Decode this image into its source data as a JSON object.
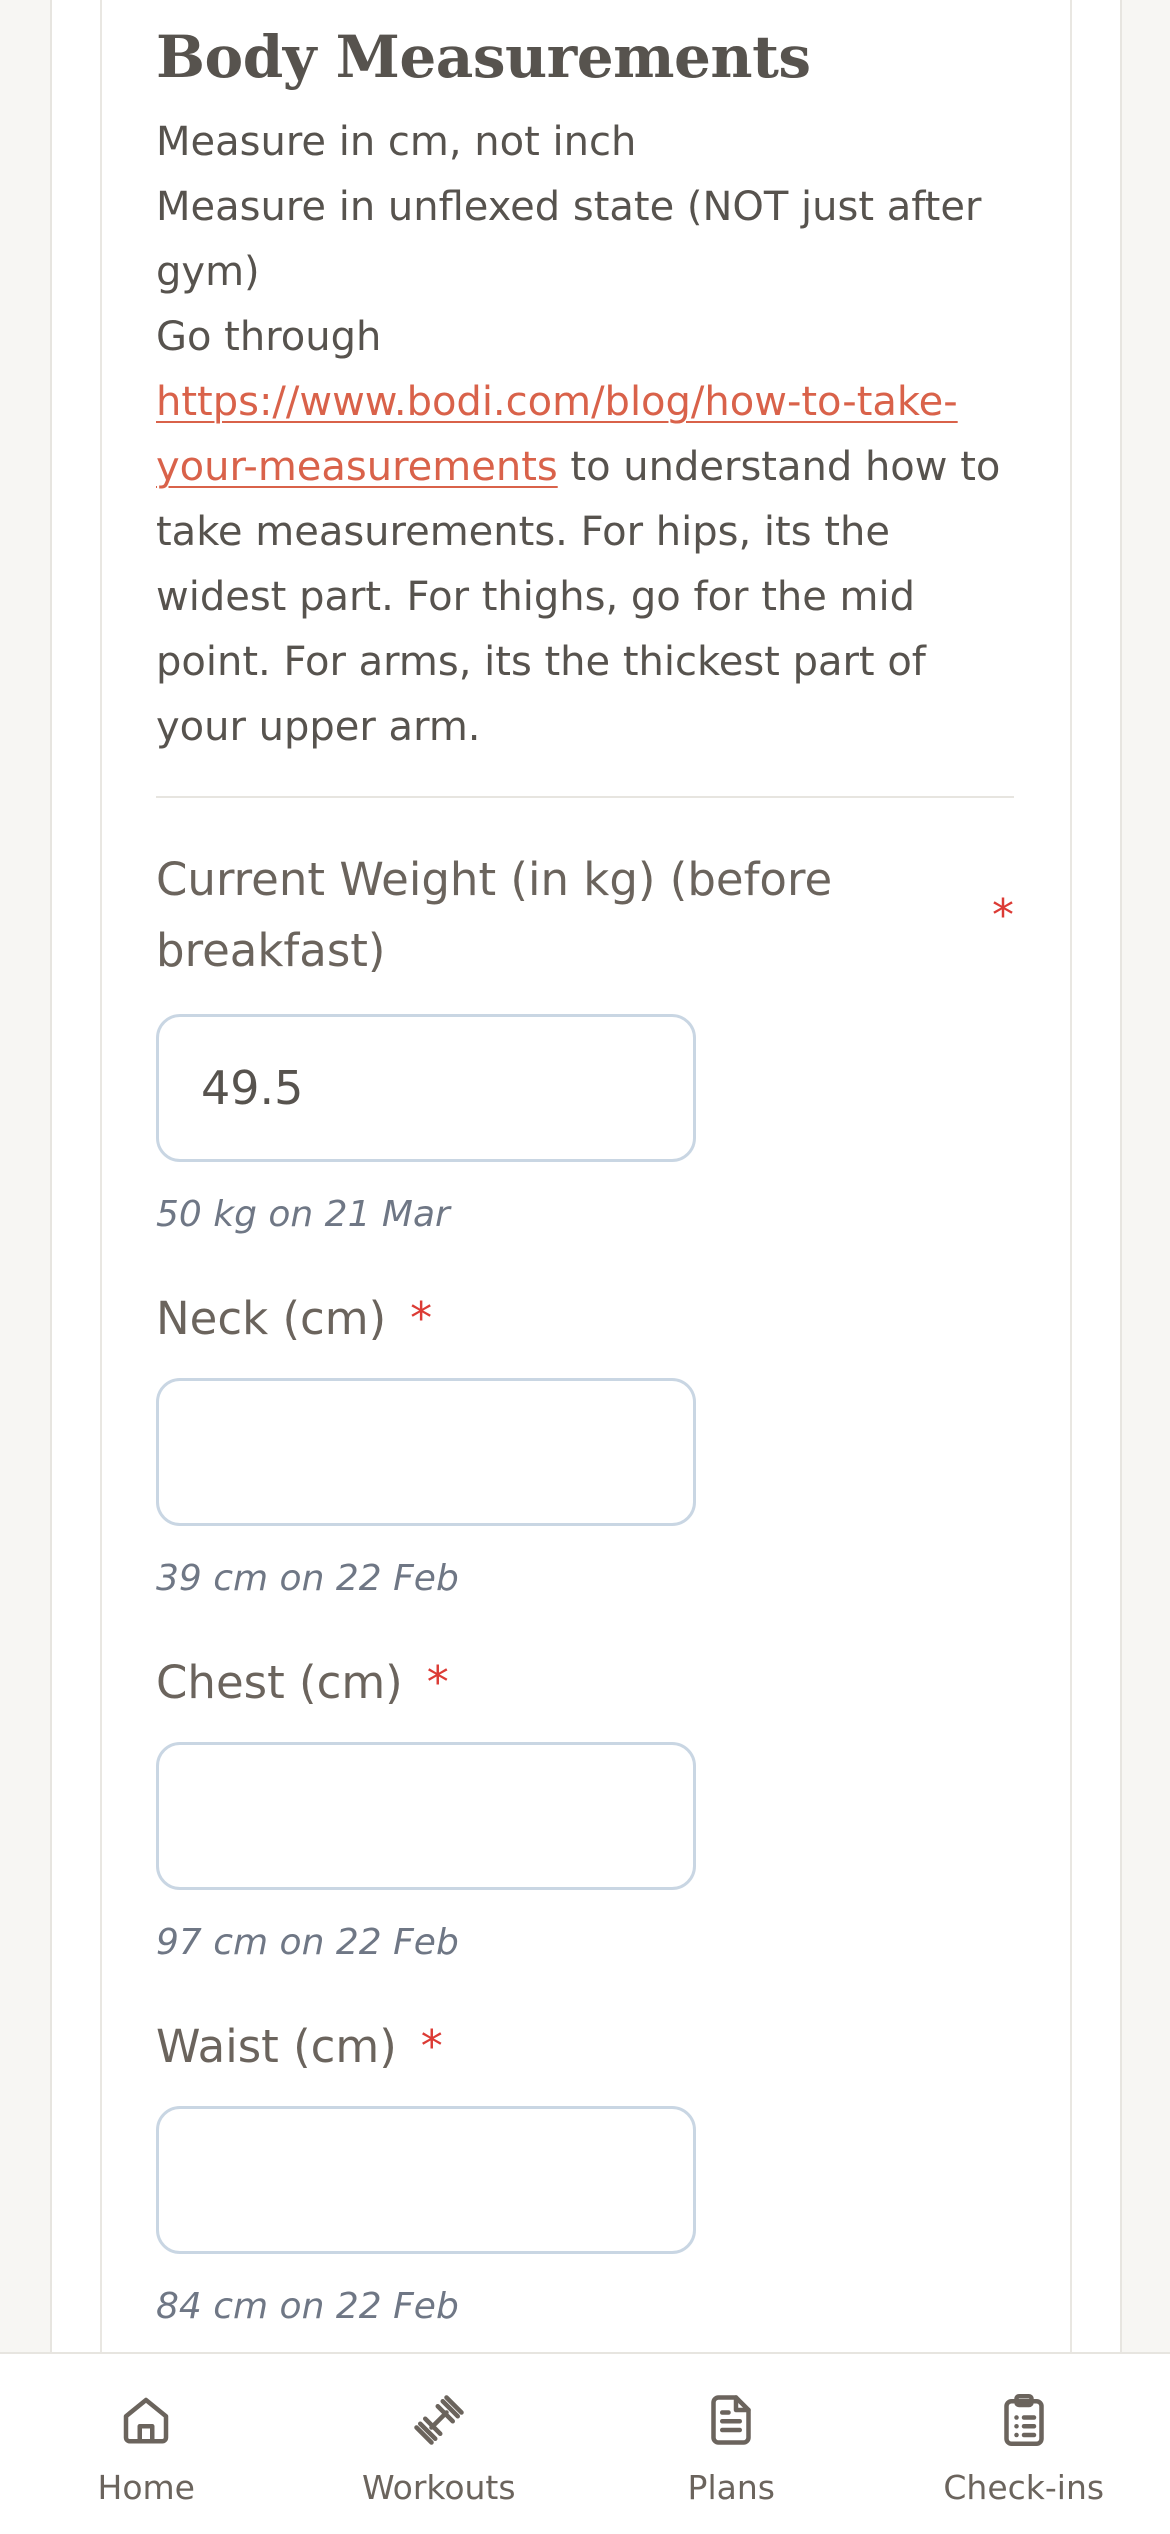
{
  "section": {
    "title": "Body Measurements",
    "instructions": {
      "line1": "Measure in cm, not inch",
      "line2": "Measure in unflexed state (NOT just after gym)",
      "line3_prefix": "Go through",
      "link_text": "https://www.bodi.com/blog/how-to-take-your-measurements",
      "line3_suffix": " to understand how to take measurements. For hips, its the widest part. For thighs, go for the mid point. For arms, its the thickest part of your upper arm."
    }
  },
  "fields": {
    "weight": {
      "label": "Current Weight (in kg) (before breakfast)",
      "required_mark": "*",
      "value": "49.5",
      "hint": "50 kg on 21 Mar"
    },
    "neck": {
      "label": "Neck (cm)",
      "required_mark": "*",
      "value": "",
      "hint": "39 cm on 22 Feb"
    },
    "chest": {
      "label": "Chest (cm)",
      "required_mark": "*",
      "value": "",
      "hint": "97 cm on 22 Feb"
    },
    "waist": {
      "label": "Waist (cm)",
      "required_mark": "*",
      "value": "",
      "hint": "84 cm on 22 Feb"
    }
  },
  "bottom_nav": {
    "items": [
      {
        "label": "Home",
        "icon": "home-icon"
      },
      {
        "label": "Workouts",
        "icon": "dumbbell-icon"
      },
      {
        "label": "Plans",
        "icon": "document-icon"
      },
      {
        "label": "Check-ins",
        "icon": "clipboard-list-icon"
      }
    ]
  },
  "colors": {
    "accent_link": "#d9624a",
    "required": "#dc3b35",
    "input_border": "#c9d6e3",
    "text": "#57534e",
    "hint": "#6f7785"
  }
}
